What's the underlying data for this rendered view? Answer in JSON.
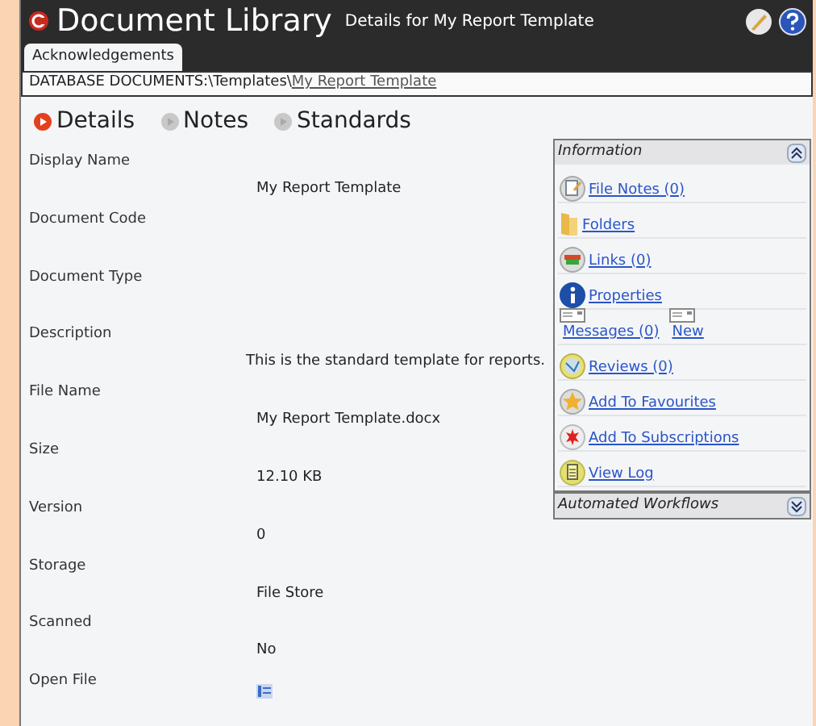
{
  "header": {
    "title": "Document Library",
    "subtitle": "Details for My Report Template"
  },
  "tabs": [
    {
      "label": "Acknowledgements",
      "selected": true
    }
  ],
  "breadcrumb": {
    "path": "DATABASE DOCUMENTS:\\Templates\\",
    "link": "My Report Template"
  },
  "sub_tabs": [
    {
      "label": "Details",
      "selected": true
    },
    {
      "label": "Notes",
      "selected": false
    },
    {
      "label": "Standards",
      "selected": false
    }
  ],
  "fields": [
    {
      "label": "Display Name",
      "value": "My Report Template"
    },
    {
      "label": "Document Code"
    },
    {
      "label": "Document Type"
    },
    {
      "label": "Description",
      "value": "This is the standard template for reports."
    },
    {
      "label": "File Name",
      "value": "My Report Template.docx"
    },
    {
      "label": "Size",
      "value": "12.10 KB"
    },
    {
      "label": "Version",
      "value": "0"
    },
    {
      "label": "Storage",
      "value": "File Store"
    },
    {
      "label": "Scanned",
      "value": "No"
    },
    {
      "label": "Open File",
      "kind": "icon"
    }
  ],
  "panels": [
    {
      "title": "Information",
      "expanded": true,
      "items": [
        {
          "links": [
            "File Notes (0)"
          ]
        },
        {
          "links": [
            "Folders"
          ]
        },
        {
          "links": [
            "Links (0)"
          ]
        },
        {
          "links": [
            "Properties"
          ]
        },
        {
          "links": [
            "Messages (0)",
            "New"
          ],
          "kind": "messages"
        },
        {
          "links": [
            "Reviews (0)"
          ]
        },
        {
          "links": [
            "Add To Favourites"
          ]
        },
        {
          "links": [
            "Add To Subscriptions"
          ]
        },
        {
          "links": [
            "View Log"
          ]
        }
      ]
    },
    {
      "title": "Automated Workflows",
      "expanded": false
    }
  ]
}
